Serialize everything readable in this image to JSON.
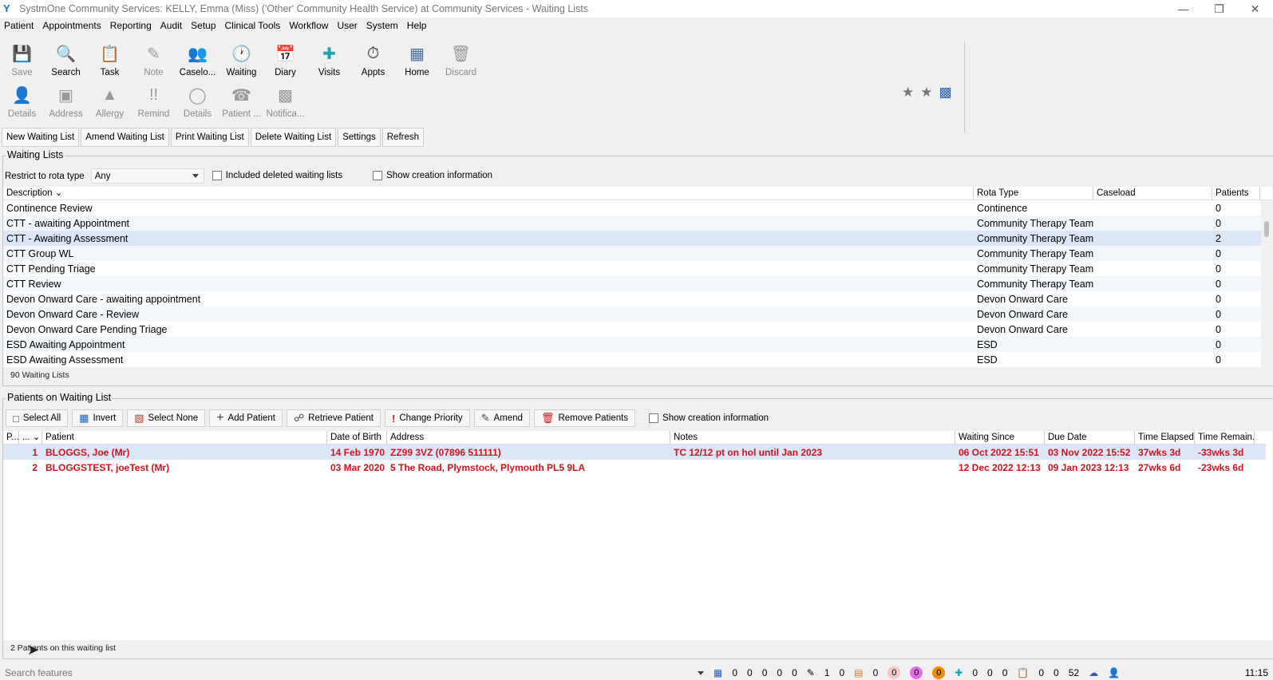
{
  "window": {
    "title": "SystmOne Community Services: KELLY, Emma (Miss) ('Other' Community Health Service) at Community Services - Waiting Lists"
  },
  "menu": [
    "Patient",
    "Appointments",
    "Reporting",
    "Audit",
    "Setup",
    "Clinical Tools",
    "Workflow",
    "User",
    "System",
    "Help"
  ],
  "toolbar_row1": [
    {
      "label": "Save",
      "icon": "save-icon",
      "enabled": false
    },
    {
      "label": "Search",
      "icon": "search-icon",
      "enabled": true
    },
    {
      "label": "Task",
      "icon": "task-icon",
      "enabled": true
    },
    {
      "label": "Note",
      "icon": "note-icon",
      "enabled": false
    },
    {
      "label": "Caselo...",
      "icon": "caseload-icon",
      "enabled": true
    },
    {
      "label": "Waiting",
      "icon": "waiting-icon",
      "enabled": true
    },
    {
      "label": "Diary",
      "icon": "diary-icon",
      "enabled": true
    },
    {
      "label": "Visits",
      "icon": "visits-icon",
      "enabled": true
    },
    {
      "label": "Appts",
      "icon": "appts-icon",
      "enabled": true
    },
    {
      "label": "Home",
      "icon": "home-icon",
      "enabled": true
    },
    {
      "label": "Discard",
      "icon": "discard-icon",
      "enabled": false
    }
  ],
  "toolbar_row2": [
    {
      "label": "Details",
      "icon": "patient-details-icon"
    },
    {
      "label": "Address",
      "icon": "address-icon"
    },
    {
      "label": "Allergy",
      "icon": "allergy-icon"
    },
    {
      "label": "Remind",
      "icon": "remind-icon"
    },
    {
      "label": "Details",
      "icon": "details-circle-icon"
    },
    {
      "label": "Patient ...",
      "icon": "phone-icon"
    },
    {
      "label": "Notifica...",
      "icon": "notification-icon"
    }
  ],
  "actions": [
    "New Waiting List",
    "Amend Waiting List",
    "Print Waiting List",
    "Delete Waiting List",
    "Settings",
    "Refresh"
  ],
  "waiting_lists": {
    "group_label": "Waiting Lists",
    "restrict_label": "Restrict to rota type",
    "restrict_value": "Any",
    "include_deleted_label": "Included deleted waiting lists",
    "show_creation_label": "Show creation information",
    "columns": [
      "Description",
      "Rota Type",
      "Caseload",
      "Patients"
    ],
    "rows": [
      {
        "description": "Continence Review",
        "rota": "Continence",
        "caseload": "",
        "patients": "0"
      },
      {
        "description": "CTT - awaiting Appointment",
        "rota": "Community Therapy Team",
        "caseload": "",
        "patients": "0"
      },
      {
        "description": "CTT - Awaiting Assessment",
        "rota": "Community Therapy Team",
        "caseload": "",
        "patients": "2"
      },
      {
        "description": "CTT Group WL",
        "rota": "Community Therapy Team",
        "caseload": "",
        "patients": "0"
      },
      {
        "description": "CTT Pending Triage",
        "rota": "Community Therapy Team",
        "caseload": "",
        "patients": "0"
      },
      {
        "description": "CTT Review",
        "rota": "Community Therapy Team",
        "caseload": "",
        "patients": "0"
      },
      {
        "description": "Devon Onward Care - awaiting appointment",
        "rota": "Devon Onward Care",
        "caseload": "",
        "patients": "0"
      },
      {
        "description": "Devon Onward Care - Review",
        "rota": "Devon Onward Care",
        "caseload": "",
        "patients": "0"
      },
      {
        "description": "Devon Onward Care Pending Triage",
        "rota": "Devon Onward Care",
        "caseload": "",
        "patients": "0"
      },
      {
        "description": "ESD Awaiting Appointment",
        "rota": "ESD",
        "caseload": "",
        "patients": "0"
      },
      {
        "description": "ESD Awaiting Assessment",
        "rota": "ESD",
        "caseload": "",
        "patients": "0"
      }
    ],
    "selected_index": 2,
    "count_text": "90 Waiting Lists"
  },
  "patients": {
    "group_label": "Patients on Waiting List",
    "buttons": [
      {
        "label": "Select All",
        "icon": "select-all-icon"
      },
      {
        "label": "Invert",
        "icon": "invert-icon"
      },
      {
        "label": "Select None",
        "icon": "select-none-icon"
      },
      {
        "label": "Add Patient",
        "icon": "add-icon"
      },
      {
        "label": "Retrieve Patient",
        "icon": "retrieve-icon"
      },
      {
        "label": "Change Priority",
        "icon": "priority-icon"
      },
      {
        "label": "Amend",
        "icon": "amend-icon"
      },
      {
        "label": "Remove Patients",
        "icon": "trash-icon"
      }
    ],
    "show_creation_label": "Show creation information",
    "columns": [
      "P...",
      "...",
      "Patient",
      "Date of Birth",
      "Address",
      "Notes",
      "Waiting Since",
      "Due Date",
      "Time Elapsed",
      "Time Remain..."
    ],
    "rows": [
      {
        "num": "1",
        "patient": "BLOGGS, Joe (Mr)",
        "dob": "14 Feb 1970",
        "address": "ZZ99 3VZ (07896 511111)",
        "notes": "TC 12/12 pt on hol until Jan 2023",
        "since": "06 Oct 2022 15:51",
        "due": "03 Nov 2022 15:52",
        "elapsed": "37wks 3d",
        "remain": "-33wks 3d"
      },
      {
        "num": "2",
        "patient": "BLOGGSTEST, joeTest (Mr)",
        "dob": "03 Mar 2020",
        "address": "5 The Road, Plymstock, Plymouth PL5 9LA",
        "notes": "",
        "since": "12 Dec 2022 12:13",
        "due": "09 Jan 2023 12:13",
        "elapsed": "27wks 6d",
        "remain": "-23wks 6d"
      }
    ],
    "count_text": "2 Patients on this waiting list"
  },
  "statusbar": {
    "search_placeholder": "Search features",
    "counters": [
      "0",
      "0",
      "0",
      "0",
      "0",
      "1",
      "0",
      "0",
      "0",
      "0",
      "0",
      "0",
      "0",
      "0",
      "0",
      "0",
      "52"
    ],
    "time": "11:15"
  }
}
